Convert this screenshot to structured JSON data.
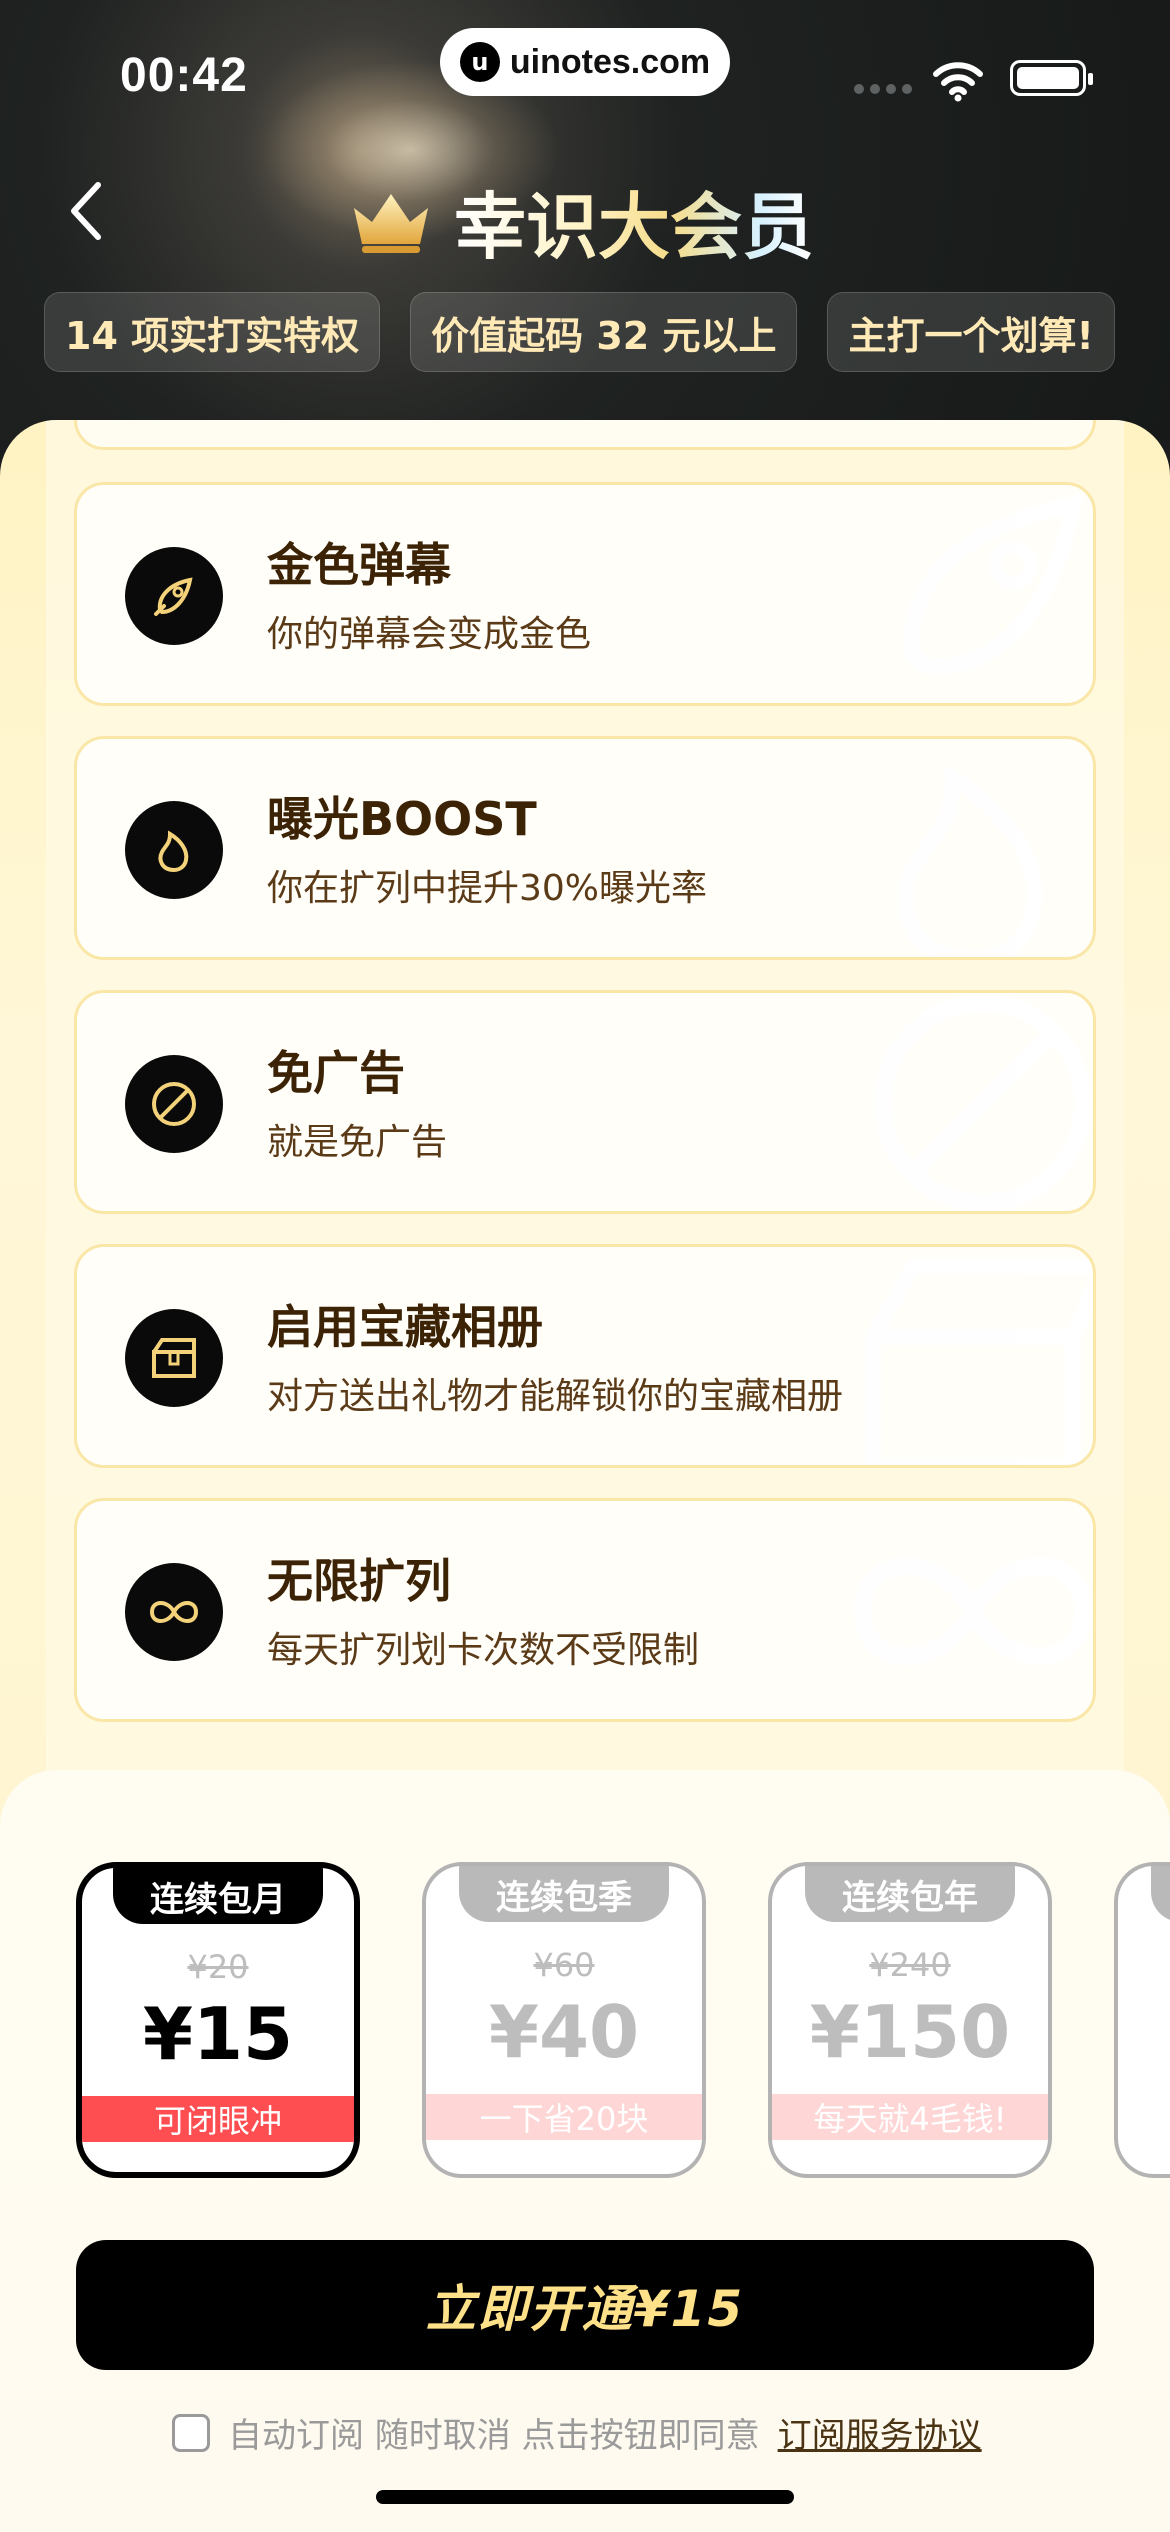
{
  "status_bar": {
    "time": "00:42",
    "url": "uinotes.com",
    "url_logo": "u"
  },
  "header": {
    "title": "幸识大会员",
    "tags": [
      "14 项实打实特权",
      "价值起码 32 元以上",
      "主打一个划算!"
    ]
  },
  "features": [
    {
      "title": "金色弹幕",
      "desc": "你的弹幕会变成金色",
      "icon": "rocket-icon"
    },
    {
      "title": "曝光BOOST",
      "desc": "你在扩列中提升30%曝光率",
      "icon": "flame-icon"
    },
    {
      "title": "免广告",
      "desc": "就是免广告",
      "icon": "no-ads-icon"
    },
    {
      "title": "启用宝藏相册",
      "desc": "对方送出礼物才能解锁你的宝藏相册",
      "icon": "treasure-box-icon"
    },
    {
      "title": "无限扩列",
      "desc": "每天扩列划卡次数不受限制",
      "icon": "infinity-icon"
    }
  ],
  "plans": [
    {
      "name": "连续包月",
      "original": "¥20",
      "price": "¥15",
      "note": "可闭眼冲",
      "selected": true
    },
    {
      "name": "连续包季",
      "original": "¥60",
      "price": "¥40",
      "note": "一下省20块",
      "selected": false
    },
    {
      "name": "连续包年",
      "original": "¥240",
      "price": "¥150",
      "note": "每天就4毛钱!",
      "selected": false
    }
  ],
  "cta": {
    "label": "立即开通¥15"
  },
  "agreement": {
    "text": "自动订阅 随时取消 点击按钮即同意",
    "link": "订阅服务协议"
  },
  "colors": {
    "accent_gold": "#ffe18a",
    "card_border": "#fae7a8",
    "red": "#ff4e52"
  }
}
